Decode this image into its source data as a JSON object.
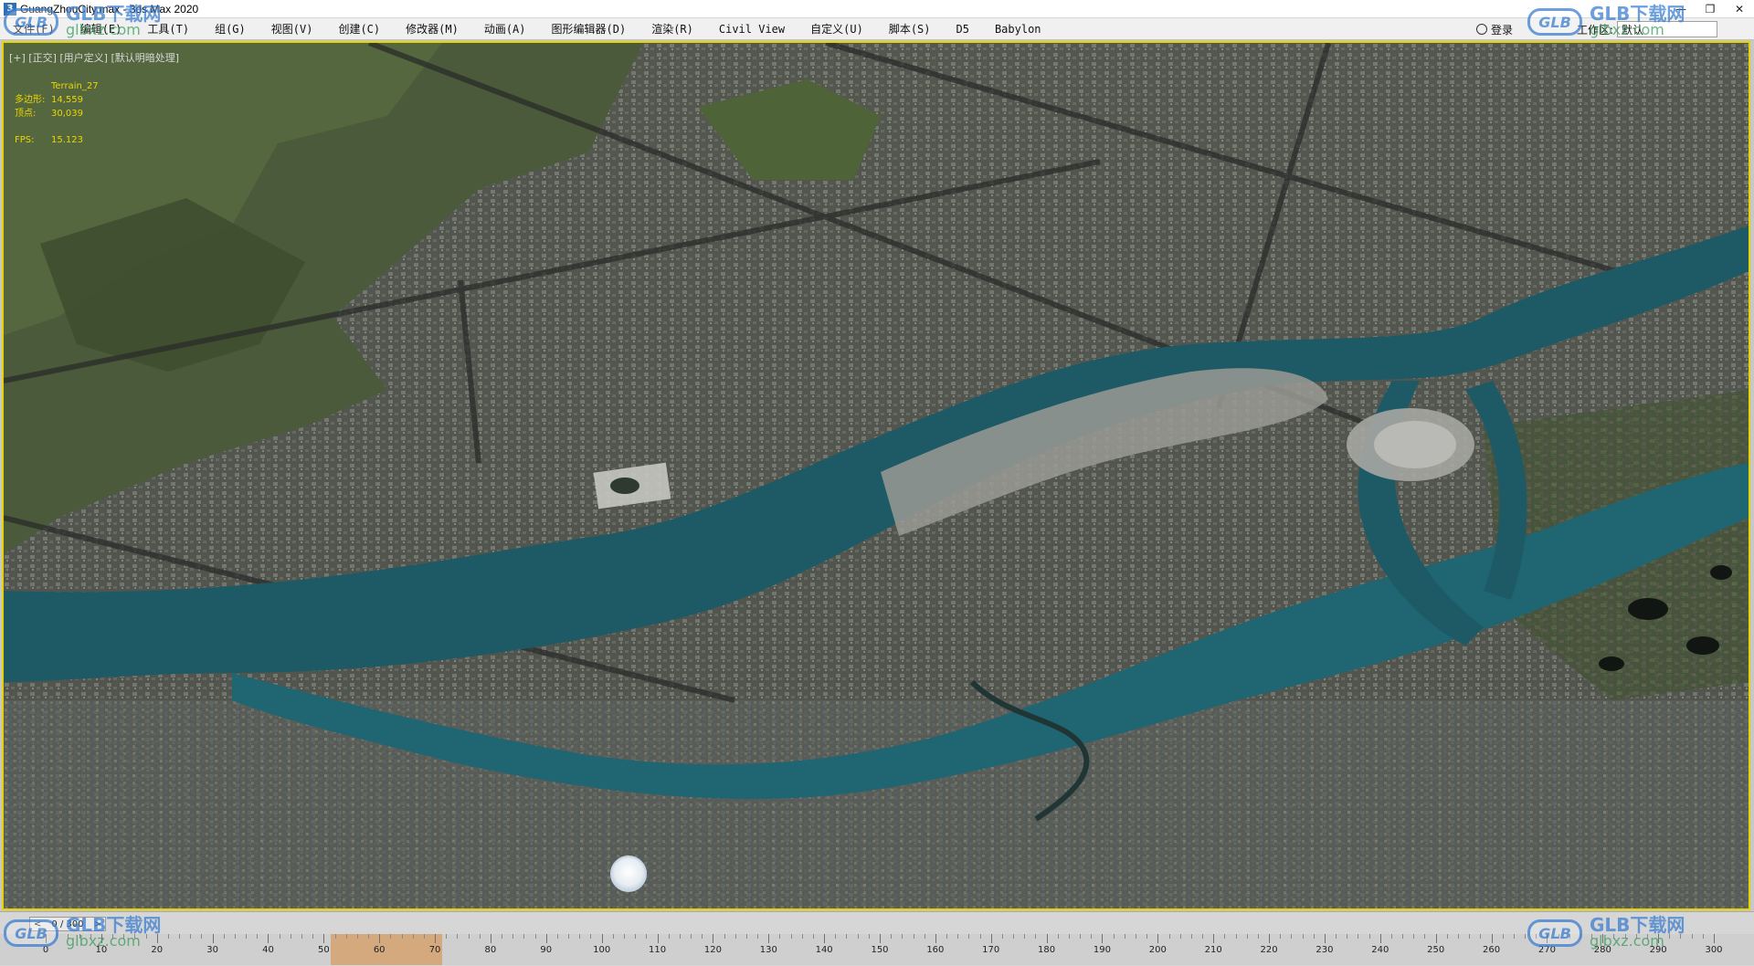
{
  "window": {
    "title": "GuangZhouCity.max - 3ds Max 2020",
    "app_icon": "3"
  },
  "menubar": {
    "items": [
      {
        "label": "文件(F)"
      },
      {
        "label": "编辑(E)"
      },
      {
        "label": "工具(T)"
      },
      {
        "label": "组(G)"
      },
      {
        "label": "视图(V)"
      },
      {
        "label": "创建(C)"
      },
      {
        "label": "修改器(M)"
      },
      {
        "label": "动画(A)"
      },
      {
        "label": "图形编辑器(D)"
      },
      {
        "label": "渲染(R)"
      },
      {
        "label": "Civil View"
      },
      {
        "label": "自定义(U)"
      },
      {
        "label": "脚本(S)"
      },
      {
        "label": "D5"
      },
      {
        "label": "Babylon"
      }
    ],
    "signin_label": "登录",
    "workspace_label": "工作区:",
    "workspace_value": "默认"
  },
  "viewport": {
    "label": "[+] [正交] [用户定义] [默认明暗处理]",
    "object_name": "Terrain_27",
    "stats": [
      {
        "key": "多边形:",
        "value": "14,559"
      },
      {
        "key": "顶点:",
        "value": "30,039"
      }
    ],
    "fps_key": "FPS:",
    "fps_value": "15.123"
  },
  "timeline": {
    "frame_display": "0 / 300",
    "prev_symbol": "<",
    "next_symbol": ">",
    "ticks": [
      "0",
      "10",
      "20",
      "30",
      "40",
      "50",
      "60",
      "70",
      "80",
      "90",
      "100",
      "110",
      "120",
      "130",
      "140",
      "150",
      "160",
      "170",
      "180",
      "190",
      "200",
      "210",
      "220",
      "230",
      "240",
      "250",
      "260",
      "270",
      "280",
      "290",
      "300"
    ]
  },
  "watermark": {
    "badge": "GLB",
    "title": "GLB下载网",
    "url": "glbxz.com"
  },
  "colors": {
    "viewport_border": "#e6d400",
    "stats_text": "#ecd600",
    "river": "#1d5a66",
    "terrain_green": "#4d5b3c",
    "urban_gray": "#5e605a"
  }
}
